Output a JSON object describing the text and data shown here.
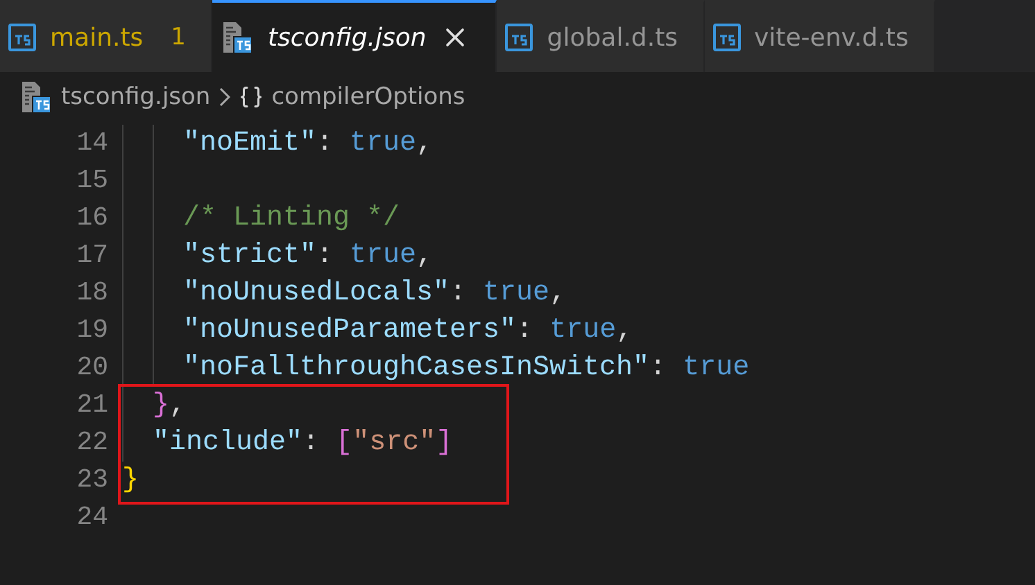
{
  "tabs": [
    {
      "label": "main.ts",
      "kind": "ts",
      "selected": false,
      "problem_count": "1"
    },
    {
      "label": "tsconfig.json",
      "kind": "tsconfig",
      "selected": true
    },
    {
      "label": "global.d.ts",
      "kind": "ts",
      "selected": false
    },
    {
      "label": "vite-env.d.ts",
      "kind": "ts",
      "selected": false
    }
  ],
  "breadcrumbs": [
    {
      "label": "tsconfig.json",
      "kind": "file"
    },
    {
      "label": "compilerOptions",
      "kind": "object"
    }
  ],
  "editor": {
    "children": [
      {
        "kind": "block",
        "children": [
          {
            "kind": "block",
            "children": [
              {
                "kind": "line",
                "number": "14",
                "highlighted": false,
                "tokens": [
                  {
                    "kind": "key",
                    "text": "\"noEmit\""
                  },
                  {
                    "kind": "punct",
                    "text": ": "
                  },
                  {
                    "kind": "keyword",
                    "text": "true"
                  },
                  {
                    "kind": "punct",
                    "text": ","
                  }
                ]
              },
              {
                "kind": "line",
                "number": "15",
                "highlighted": false
              },
              {
                "kind": "line",
                "number": "16",
                "highlighted": false,
                "tokens": [
                  {
                    "kind": "comment",
                    "text": "/* Linting */"
                  }
                ]
              },
              {
                "kind": "line",
                "number": "17",
                "highlighted": false,
                "tokens": [
                  {
                    "kind": "key",
                    "text": "\"strict\""
                  },
                  {
                    "kind": "punct",
                    "text": ": "
                  },
                  {
                    "kind": "keyword",
                    "text": "true"
                  },
                  {
                    "kind": "punct",
                    "text": ","
                  }
                ]
              },
              {
                "kind": "line",
                "number": "18",
                "highlighted": false,
                "tokens": [
                  {
                    "kind": "key",
                    "text": "\"noUnusedLocals\""
                  },
                  {
                    "kind": "punct",
                    "text": ": "
                  },
                  {
                    "kind": "keyword",
                    "text": "true"
                  },
                  {
                    "kind": "punct",
                    "text": ","
                  }
                ]
              },
              {
                "kind": "line",
                "number": "19",
                "highlighted": false,
                "tokens": [
                  {
                    "kind": "key",
                    "text": "\"noUnusedParameters\""
                  },
                  {
                    "kind": "punct",
                    "text": ": "
                  },
                  {
                    "kind": "keyword",
                    "text": "true"
                  },
                  {
                    "kind": "punct",
                    "text": ","
                  }
                ]
              },
              {
                "kind": "line",
                "number": "20",
                "highlighted": false,
                "tokens": [
                  {
                    "kind": "key",
                    "text": "\"noFallthroughCasesInSwitch\""
                  },
                  {
                    "kind": "punct",
                    "text": ": "
                  },
                  {
                    "kind": "keyword",
                    "text": "true"
                  }
                ]
              }
            ]
          },
          {
            "kind": "line",
            "number": "21",
            "highlighted": true,
            "tokens": [
              {
                "kind": "bracket2",
                "text": "}"
              },
              {
                "kind": "punct",
                "text": ","
              }
            ]
          },
          {
            "kind": "line",
            "number": "22",
            "highlighted": true,
            "tokens": [
              {
                "kind": "key",
                "text": "\"include\""
              },
              {
                "kind": "punct",
                "text": ": "
              },
              {
                "kind": "bracket2",
                "text": "["
              },
              {
                "kind": "string",
                "text": "\"src\""
              },
              {
                "kind": "bracket2",
                "text": "]"
              }
            ]
          }
        ]
      },
      {
        "kind": "line",
        "number": "23",
        "highlighted": true,
        "tokens": [
          {
            "kind": "bracket1",
            "text": "}"
          }
        ]
      },
      {
        "kind": "line",
        "number": "24",
        "highlighted": false
      }
    ]
  }
}
